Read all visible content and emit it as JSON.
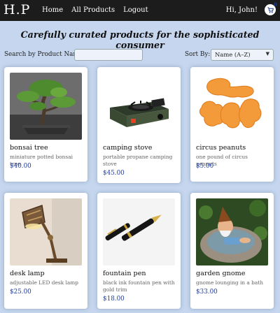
{
  "nav": {
    "brand": "H.P",
    "links": [
      "Home",
      "All Products",
      "Logout"
    ],
    "greeting": "Hi, John!",
    "cart_count": "0"
  },
  "tagline": "Carefully curated products for the sophisticated consumer",
  "search": {
    "label": "Search by Product Name:",
    "value": "",
    "placeholder": ""
  },
  "sort": {
    "label": "Sort By:",
    "selected": "Name (A–Z)"
  },
  "products": [
    {
      "name": "bonsai tree",
      "description": "miniature potted bonsai tree",
      "price": "$40.00",
      "image_icon": "bonsai-tree-image"
    },
    {
      "name": "camping stove",
      "description": "portable propane camping stove",
      "price": "$45.00",
      "image_icon": "camping-stove-image"
    },
    {
      "name": "circus peanuts",
      "description": "one pound of circus peanuts",
      "price": "$5.00",
      "image_icon": "circus-peanuts-image"
    },
    {
      "name": "desk lamp",
      "description": "adjustable LED desk lamp",
      "price": "$25.00",
      "image_icon": "desk-lamp-image"
    },
    {
      "name": "fountain pen",
      "description": "black ink fountain pen with gold trim",
      "price": "$18.00",
      "image_icon": "fountain-pen-image"
    },
    {
      "name": "garden gnome",
      "description": "gnome lounging in a bath",
      "price": "$33.00",
      "image_icon": "garden-gnome-image"
    }
  ],
  "colors": {
    "navbar": "#1c1c1c",
    "background": "#c5d6ee",
    "price": "#1f3c9e",
    "card": "#ffffff"
  }
}
